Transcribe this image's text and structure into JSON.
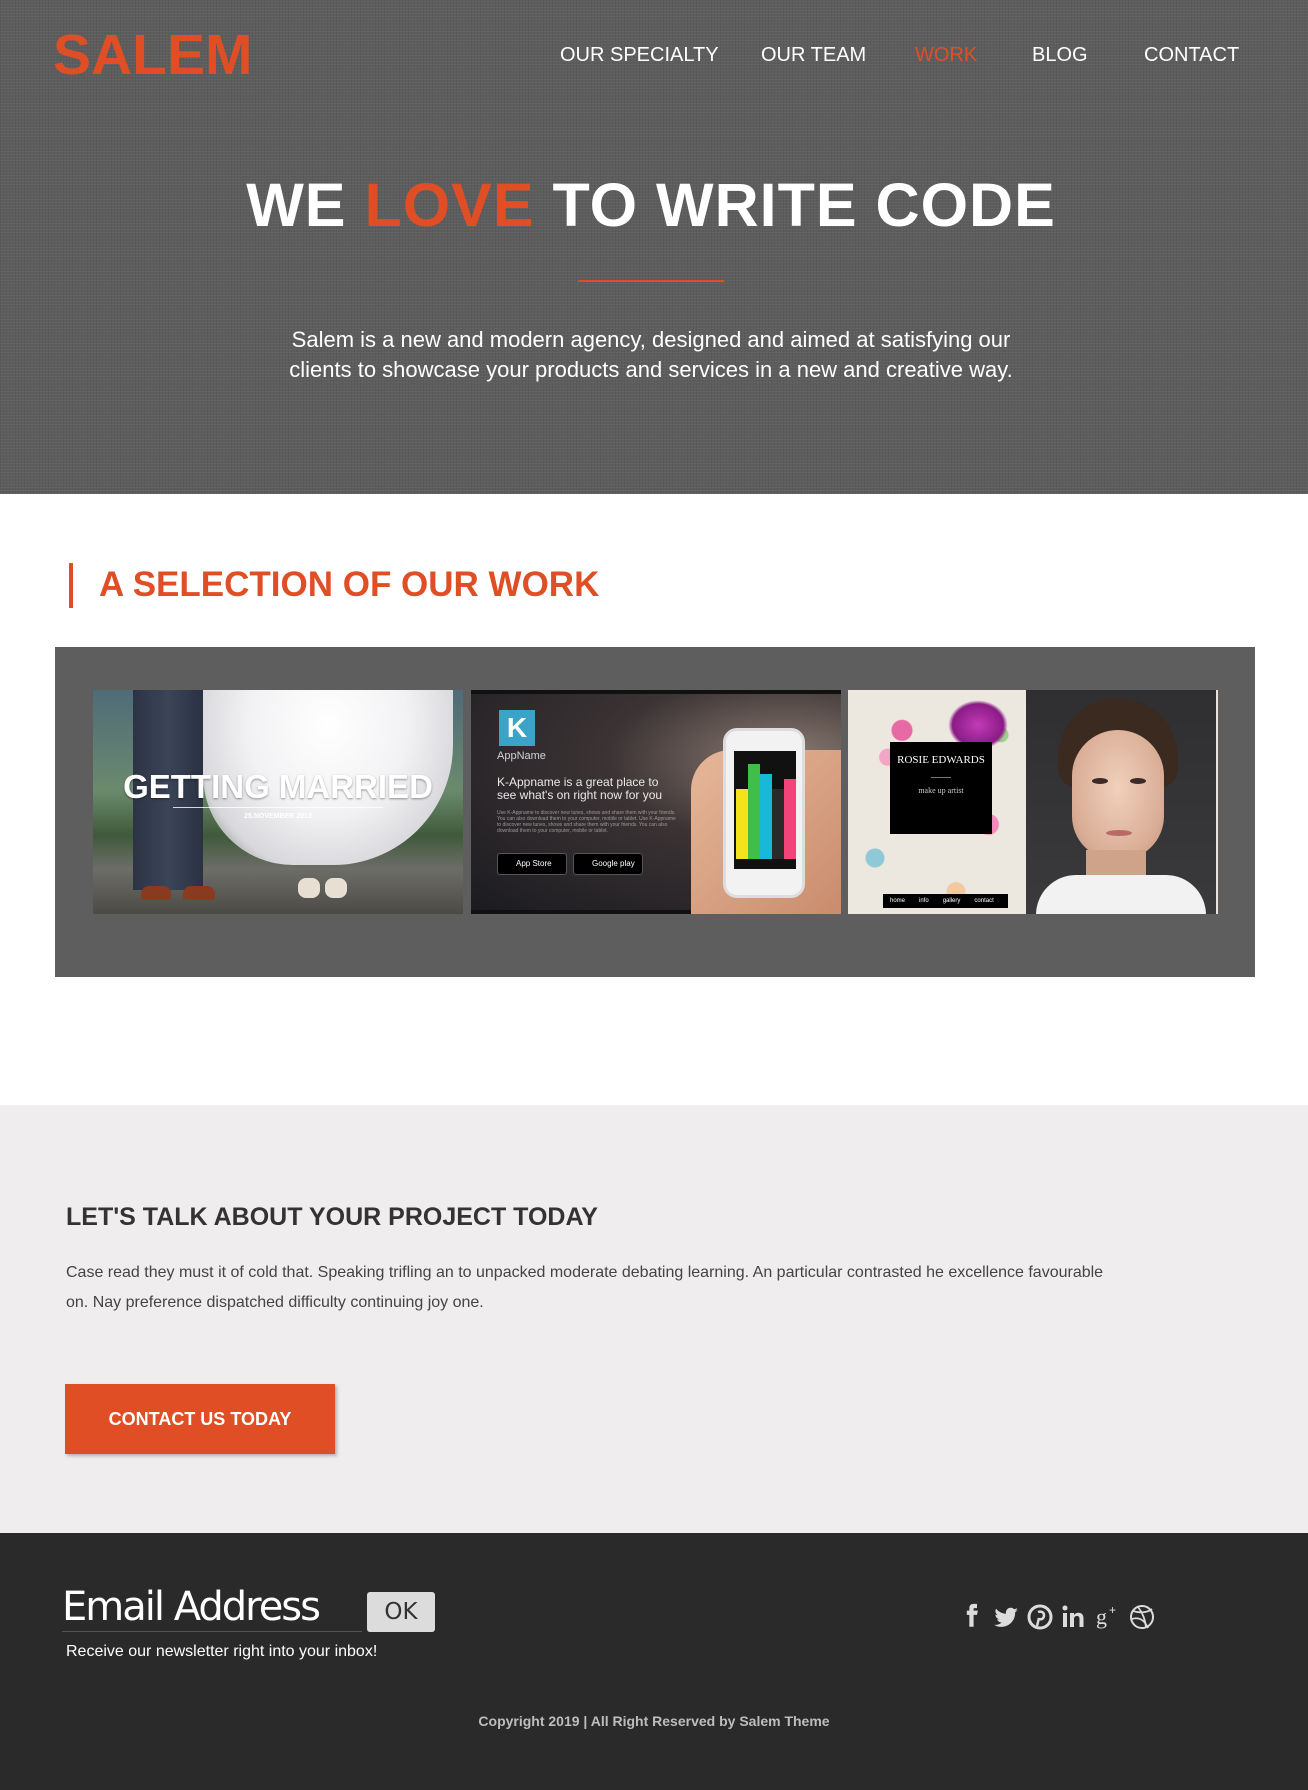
{
  "brand": {
    "logo": "SALEM",
    "accent_color": "#e04e26"
  },
  "nav": {
    "items": [
      {
        "label": "OUR SPECIALTY",
        "active": false
      },
      {
        "label": "OUR TEAM",
        "active": false
      },
      {
        "label": "WORK",
        "active": true
      },
      {
        "label": "BLOG",
        "active": false
      },
      {
        "label": "CONTACT",
        "active": false
      }
    ]
  },
  "hero": {
    "title_before": "WE ",
    "title_accent": "LOVE",
    "title_after": " TO WRITE CODE",
    "description": "Salem is a new and modern agency, designed and aimed at satisfying our clients to showcase your products and services in a new and creative way."
  },
  "work": {
    "heading": "A SELECTION OF OUR WORK",
    "thumb1": {
      "title": "GETTING MARRIED",
      "date": "25.NOVEMBER 2013"
    },
    "thumb2": {
      "app_name": "AppName",
      "tagline": "K-Appname is a great place to see what's on right now for you",
      "body": "Use K-Appname to discover new tunes, shows and share them with your friends. You can also download them to your computer, mobile or tablet. Use K-Appname to discover new tunes, shows and share them with your friends. You can also download them to your computer, mobile or tablet.",
      "badge_appstore": "App Store",
      "badge_googleplay": "Google play"
    },
    "thumb3": {
      "name": "ROSIE EDWARDS",
      "role": "make up artist",
      "menu": [
        "home",
        "info",
        "gallery",
        "contact"
      ]
    }
  },
  "contact": {
    "title": "LET'S TALK ABOUT YOUR PROJECT TODAY",
    "text": "Case read they must it of cold that. Speaking trifling an to unpacked moderate debating learning. An particular contrasted he excellence favourable on. Nay preference dispatched difficulty continuing joy one.",
    "button": "CONTACT US TODAY"
  },
  "footer": {
    "email_placeholder": "Email Address",
    "ok_label": "OK",
    "newsletter_text": "Receive our newsletter right into your inbox!",
    "social_icons": [
      "facebook-icon",
      "twitter-icon",
      "pinterest-icon",
      "linkedin-icon",
      "google-plus-icon",
      "dribbble-icon"
    ],
    "copyright": "Copyright 2019 | All Right Reserved by Salem Theme"
  }
}
